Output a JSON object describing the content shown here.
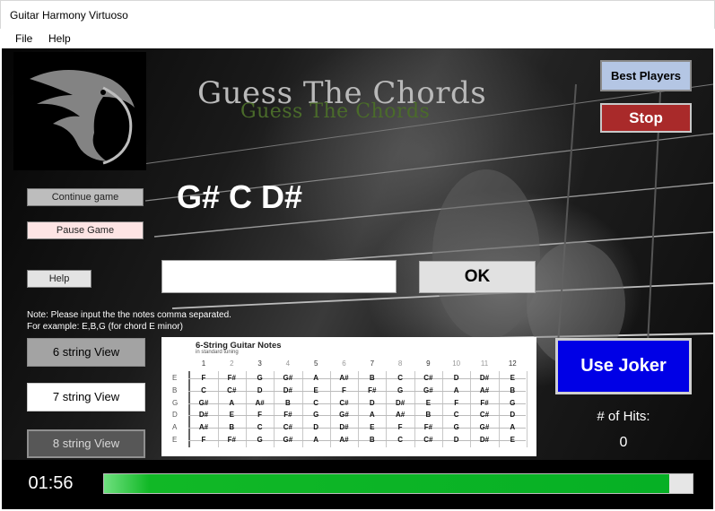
{
  "window": {
    "title": "Guitar Harmony Virtuoso"
  },
  "menu": {
    "file": "File",
    "help": "Help"
  },
  "banner": {
    "text": "Guess The Chords"
  },
  "buttons": {
    "continue_game": "Continue game",
    "pause_game": "Pause Game",
    "help": "Help",
    "best_players": "Best Players",
    "stop": "Stop",
    "ok": "OK",
    "use_joker": "Use Joker"
  },
  "chord": {
    "notes": "G# C D#"
  },
  "answer": {
    "value": ""
  },
  "note": {
    "line1": "Note: Please input the the notes comma separated.",
    "line2": "For example: E,B,G (for chord E minor)"
  },
  "views": {
    "six": "6 string View",
    "seven": "7 string View",
    "eight": "8 string View"
  },
  "fretboard": {
    "title": "6-String Guitar Notes",
    "subtitle": "in standard tuning",
    "frets": [
      "1",
      "2",
      "3",
      "4",
      "5",
      "6",
      "7",
      "8",
      "9",
      "10",
      "11",
      "12"
    ],
    "strings": [
      {
        "name": "E",
        "notes": [
          "F",
          "F#",
          "G",
          "G#",
          "A",
          "A#",
          "B",
          "C",
          "C#",
          "D",
          "D#",
          "E"
        ]
      },
      {
        "name": "B",
        "notes": [
          "C",
          "C#",
          "D",
          "D#",
          "E",
          "F",
          "F#",
          "G",
          "G#",
          "A",
          "A#",
          "B"
        ]
      },
      {
        "name": "G",
        "notes": [
          "G#",
          "A",
          "A#",
          "B",
          "C",
          "C#",
          "D",
          "D#",
          "E",
          "F",
          "F#",
          "G"
        ]
      },
      {
        "name": "D",
        "notes": [
          "D#",
          "E",
          "F",
          "F#",
          "G",
          "G#",
          "A",
          "A#",
          "B",
          "C",
          "C#",
          "D"
        ]
      },
      {
        "name": "A",
        "notes": [
          "A#",
          "B",
          "C",
          "C#",
          "D",
          "D#",
          "E",
          "F",
          "F#",
          "G",
          "G#",
          "A"
        ]
      },
      {
        "name": "E",
        "notes": [
          "F",
          "F#",
          "G",
          "G#",
          "A",
          "A#",
          "B",
          "C",
          "C#",
          "D",
          "D#",
          "E"
        ]
      }
    ]
  },
  "hits": {
    "label": "# of Hits:",
    "value": "0"
  },
  "timer": {
    "value": "01:56"
  },
  "progress": {
    "fraction": 0.96
  },
  "colors": {
    "stop": "#a92a2a",
    "joker": "#0000e6",
    "progress": "#06b025",
    "best_players": "#b4c6e4"
  }
}
